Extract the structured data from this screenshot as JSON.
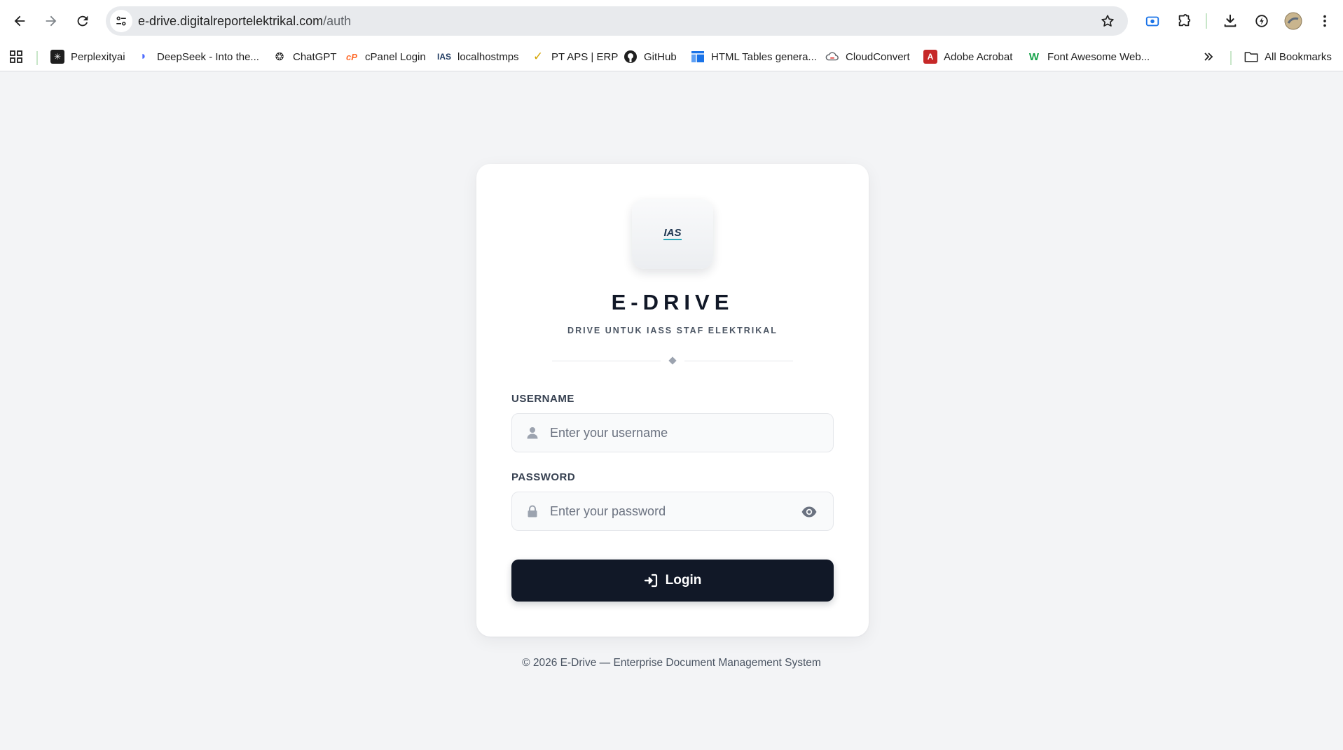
{
  "browser": {
    "url_host": "e-drive.digitalreportelektrikal.com",
    "url_path": "/auth"
  },
  "bookmarks": [
    {
      "label": "Perplexityai",
      "icon": "perplexity-icon"
    },
    {
      "label": "DeepSeek - Into the...",
      "icon": "deepseek-icon"
    },
    {
      "label": "ChatGPT",
      "icon": "chatgpt-icon"
    },
    {
      "label": "cPanel Login",
      "icon": "cpanel-icon"
    },
    {
      "label": "localhostmps",
      "icon": "ias-icon"
    },
    {
      "label": "PT APS | ERP",
      "icon": "aps-icon"
    },
    {
      "label": "GitHub",
      "icon": "github-icon"
    },
    {
      "label": "HTML Tables genera...",
      "icon": "tables-icon"
    },
    {
      "label": "CloudConvert",
      "icon": "cloudconvert-icon"
    },
    {
      "label": "Adobe Acrobat",
      "icon": "acrobat-icon"
    },
    {
      "label": "Font Awesome Web...",
      "icon": "fontawesome-icon"
    }
  ],
  "all_bookmarks_label": "All Bookmarks",
  "app": {
    "title": "E-DRIVE",
    "subtitle": "DRIVE UNTUK IASS STAF ELEKTRIKAL",
    "logo_text": "IAS"
  },
  "form": {
    "username_label": "USERNAME",
    "username_placeholder": "Enter your username",
    "password_label": "PASSWORD",
    "password_placeholder": "Enter your password",
    "login_label": "Login"
  },
  "footer": "© 2026 E-Drive — Enterprise Document Management System",
  "colors": {
    "primary": "#111827",
    "background": "#f3f4f6",
    "card": "#ffffff",
    "logo_accent": "#2aa7b8"
  }
}
